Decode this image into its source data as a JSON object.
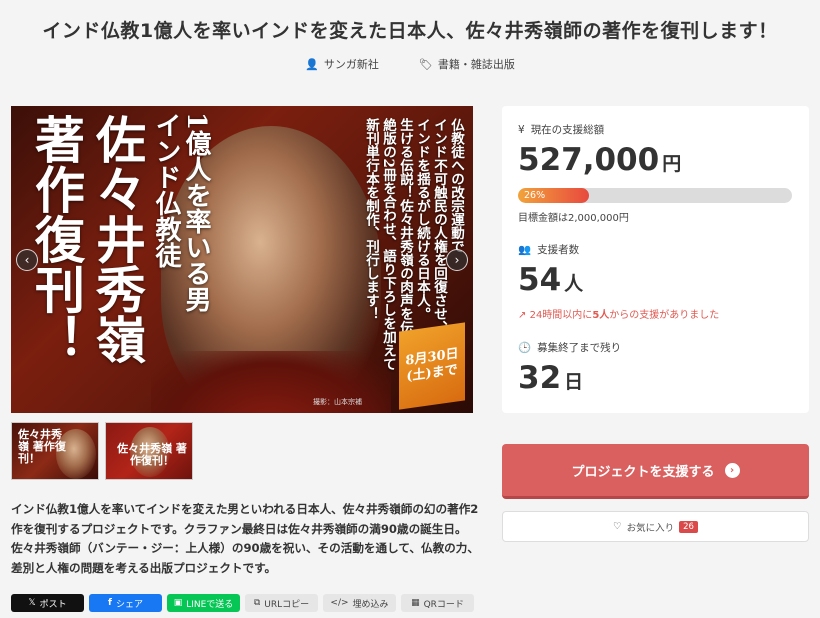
{
  "page": {
    "title": "インド仏教1億人を率いインドを変えた日本人、佐々井秀嶺師の著作を復刊します！",
    "author": "サンガ新社",
    "category": "書籍・雑誌出版"
  },
  "hero": {
    "big_line1": "著作復刊！",
    "big_line2": "佐々井秀嶺",
    "sub_line1": "インド仏教徒",
    "sub_line2": "1億人を率いる男",
    "body_lines": [
      "仏教徒への改宗運動で",
      "インド不可触民の人権を回復させ、",
      "インドを揺るがし続ける日本人。",
      "生ける伝説！佐々井秀嶺の肉声を伝える",
      "絶版の2冊を合わせ、語り下ろしを加えて",
      "新刊単行本を制作、刊行します！",
      ""
    ],
    "date_badge": "8月30日(土)まで",
    "credit": "撮影：山本宗補",
    "prev_icon": "chevron-left",
    "next_icon": "chevron-right"
  },
  "thumbnails": [
    {
      "text": "佐々井秀嶺 著作復刊！"
    },
    {
      "text": "佐々井秀嶺 著作復刊！"
    }
  ],
  "description": [
    "インド仏教1億人を率いてインドを変えた男といわれる日本人、佐々井秀嶺師の幻の著作2",
    "作を復刊するプロジェクトです。クラファン最終日は佐々井秀嶺師の満90歳の誕生日。",
    "佐々井秀嶺師（バンテー・ジー：上人様）の90歳を祝い、その活動を通して、仏教の力、",
    "差別と人権の問題を考える出版プロジェクトです。"
  ],
  "share": {
    "x": "ポスト",
    "facebook": "シェア",
    "line": "LINEで送る",
    "copy": "URLコピー",
    "embed": "埋め込み",
    "qr": "QRコード"
  },
  "stats": {
    "total_label": "現在の支援総額",
    "total_value": "527,000",
    "total_unit": "円",
    "progress_label": "26%",
    "progress_percent": 26,
    "goal": "目標金額は2,000,000円",
    "backers_label": "支援者数",
    "backers_value": "54",
    "backers_unit": "人",
    "recent_prefix": "24時間以内に",
    "recent_count": "5人",
    "recent_suffix": "からの支援がありました",
    "remaining_label": "募集終了まで残り",
    "remaining_value": "32",
    "remaining_unit": "日"
  },
  "actions": {
    "support": "プロジェクトを支援する",
    "favorite": "お気に入り",
    "favorite_count": "26"
  },
  "colors": {
    "accent": "#da5f5f",
    "progress_start": "#f2a33a",
    "progress_end": "#e8493f",
    "facebook": "#1877f2",
    "line": "#06c755",
    "x": "#111111"
  }
}
